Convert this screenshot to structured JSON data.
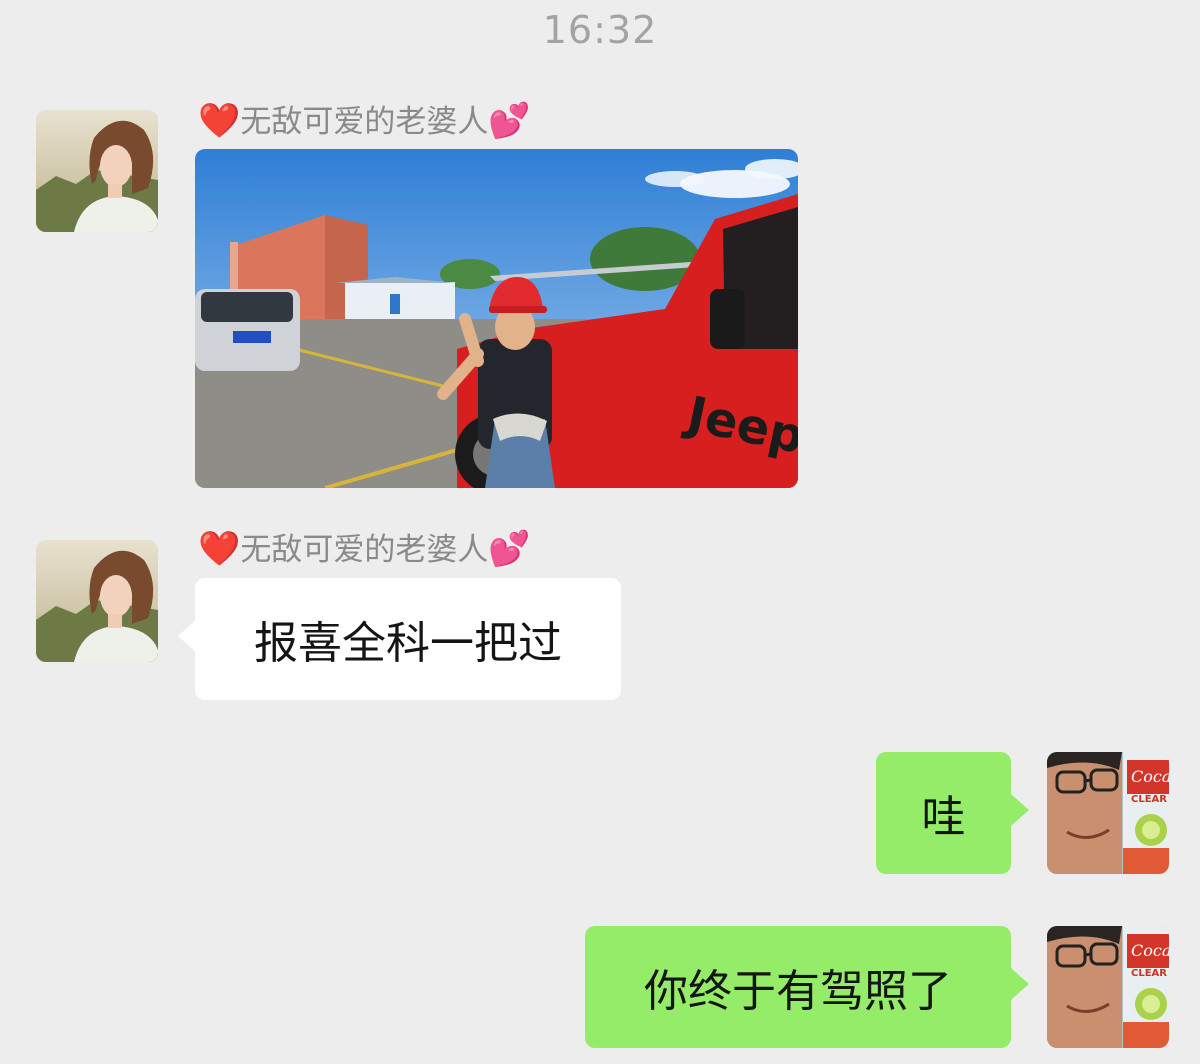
{
  "chat": {
    "timestamp": "16:32",
    "messages": [
      {
        "sender": "contact",
        "sender_name": "无敌可爱的老婆人",
        "name_emoji_before": "❤️",
        "name_emoji_after": "💕",
        "type": "image",
        "image_description": "Woman in red helmet giving a peace sign beside a red Jeep in a driving-school lot"
      },
      {
        "sender": "contact",
        "sender_name": "无敌可爱的老婆人",
        "name_emoji_before": "❤️",
        "name_emoji_after": "💕",
        "type": "text",
        "text": "报喜全科一把过"
      },
      {
        "sender": "self",
        "type": "text",
        "text": "哇"
      },
      {
        "sender": "self",
        "type": "text",
        "text": "你终于有驾照了"
      }
    ]
  },
  "colors": {
    "background": "#ededed",
    "bubble_self": "#95ec69",
    "bubble_contact": "#ffffff",
    "name_text": "#8a8a8a",
    "timestamp_text": "#a3a3a3"
  }
}
